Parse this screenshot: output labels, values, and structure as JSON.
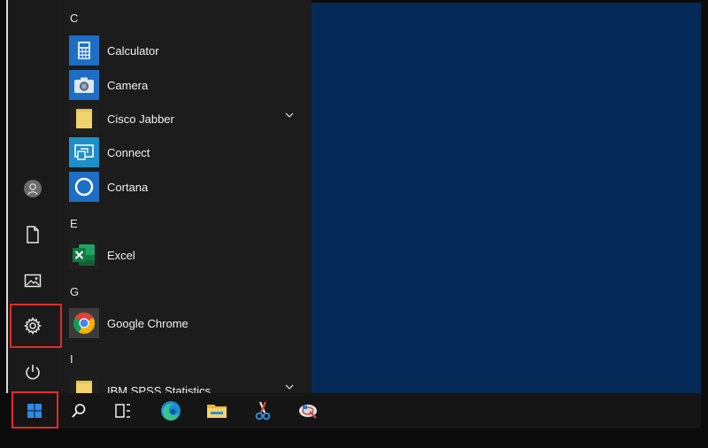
{
  "start_menu": {
    "sections": [
      {
        "letter": "C"
      },
      {
        "letter": "E"
      },
      {
        "letter": "G"
      },
      {
        "letter": "I"
      }
    ],
    "apps": [
      {
        "label": "Calculator",
        "icon": "calculator-icon",
        "color": "#1c6fc4"
      },
      {
        "label": "Camera",
        "icon": "camera-icon",
        "color": "#1c6fc4"
      },
      {
        "label": "Cisco Jabber",
        "icon": "folder-icon",
        "color": "#f2d36b",
        "expandable": true
      },
      {
        "label": "Connect",
        "icon": "connect-icon",
        "color": "#1c8fc8"
      },
      {
        "label": "Cortana",
        "icon": "cortana-icon",
        "color": "#1c6fc4"
      },
      {
        "label": "Excel",
        "icon": "excel-icon",
        "color": "#1d6f42"
      },
      {
        "label": "Google Chrome",
        "icon": "chrome-icon",
        "color": "#3c3c3c"
      },
      {
        "label": "IBM SPSS Statistics",
        "icon": "folder-icon",
        "color": "#f2d36b",
        "expandable": true
      }
    ],
    "rail": [
      "user-avatar-icon",
      "documents-icon",
      "pictures-icon",
      "settings-icon",
      "power-icon"
    ]
  },
  "taskbar": {
    "items": [
      "windows-start-icon",
      "search-icon",
      "task-view-icon",
      "edge-icon",
      "file-explorer-icon",
      "snipping-tool-icon",
      "app-icon"
    ]
  },
  "colors": {
    "desktop": "#052a57",
    "highlight": "#e32b24"
  }
}
